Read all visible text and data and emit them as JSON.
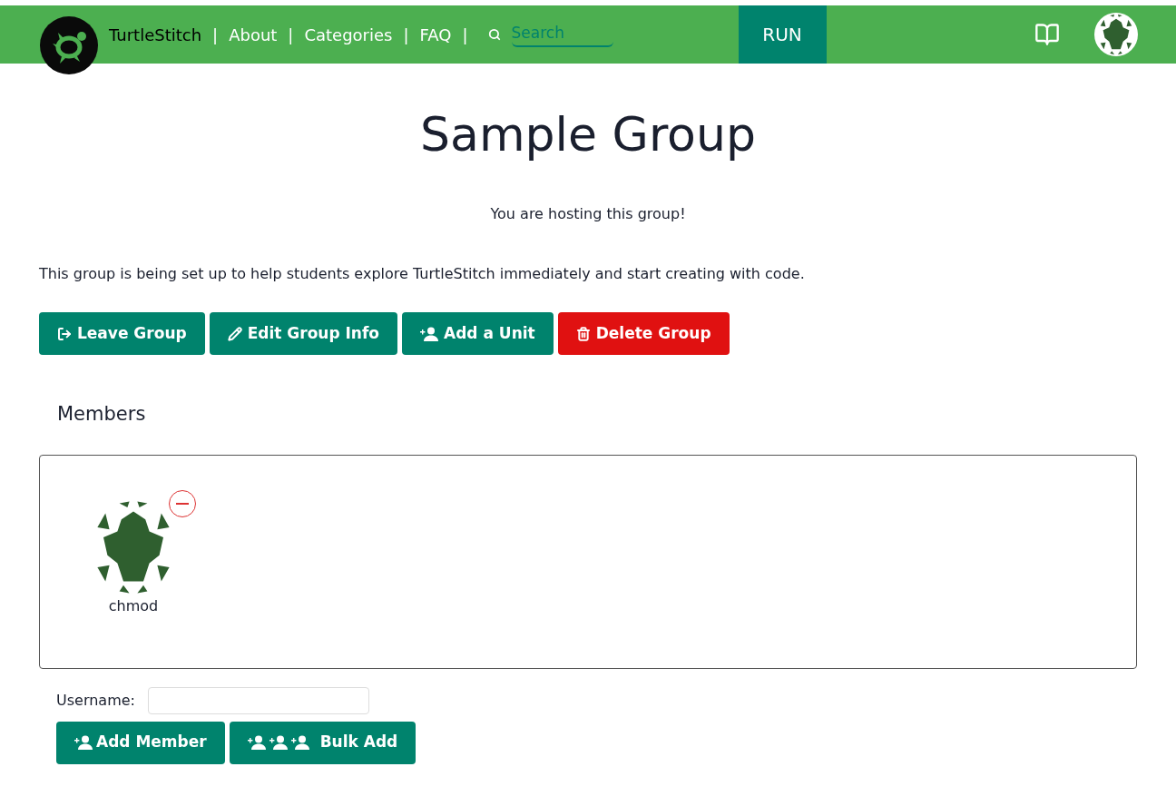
{
  "navbar": {
    "brand": "TurtleStitch",
    "separator": "|",
    "links": [
      {
        "label": "About"
      },
      {
        "label": "Categories"
      },
      {
        "label": "FAQ"
      }
    ],
    "search": {
      "placeholder": "Search"
    },
    "run": "RUN"
  },
  "title": "Sample Group",
  "hosting_note": "You are hosting this group!",
  "description": "This group is being set up to help students explore TurtleStitch immediately and start creating with code.",
  "actions": [
    {
      "kind": "leave",
      "label": "Leave Group"
    },
    {
      "kind": "edit",
      "label": "Edit Group Info"
    },
    {
      "kind": "unit",
      "label": "Add a Unit"
    },
    {
      "kind": "delete",
      "label": "Delete Group"
    }
  ],
  "members": {
    "heading": "Members",
    "items": [
      {
        "name": "chmod"
      }
    ]
  },
  "add_member": {
    "label": "Username:",
    "buttons": [
      {
        "kind": "single",
        "label": "Add Member"
      },
      {
        "kind": "bulk",
        "label": "Bulk Add"
      }
    ]
  }
}
